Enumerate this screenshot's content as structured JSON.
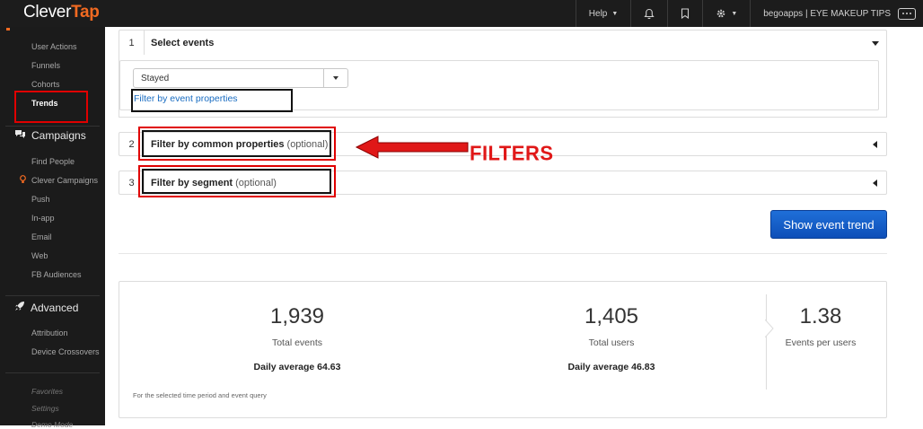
{
  "app": {
    "logo_clever": "Clever",
    "logo_tap": "Tap"
  },
  "topbar": {
    "help_label": "Help",
    "account_label": "begoapps | EYE MAKEUP TIPS",
    "bell_icon": "bell-icon",
    "bookmark_icon": "bookmark-icon",
    "gear_icon": "gear-icon"
  },
  "sidebar": {
    "analytics_items": [
      "User Actions",
      "Funnels",
      "Cohorts",
      "Trends"
    ],
    "active_item": "Trends",
    "campaigns_title": "Campaigns",
    "campaigns_items": [
      "Find People",
      "Clever Campaigns",
      "Push",
      "In-app",
      "Email",
      "Web",
      "FB Audiences"
    ],
    "advanced_title": "Advanced",
    "advanced_items": [
      "Attribution",
      "Device Crossovers"
    ],
    "footer_items": [
      "Favorites",
      "Settings",
      "Demo Mode"
    ]
  },
  "panels": {
    "select_events": {
      "num": "1",
      "title": "Select events"
    },
    "event_select_value": "Stayed",
    "filter_link": "Filter by event properties",
    "common_props": {
      "num": "2",
      "title": "Filter by common properties",
      "optional": "(optional)"
    },
    "segment": {
      "num": "3",
      "title": "Filter by segment",
      "optional": "(optional)"
    }
  },
  "annotation": {
    "filters_label": "FILTERS",
    "accent_color": "#e00000"
  },
  "actions": {
    "show_trend": "Show event trend",
    "button_color": "#1a5fc9"
  },
  "stats": {
    "total_events": {
      "value": "1,939",
      "label": "Total events",
      "daily": "Daily average 64.63"
    },
    "total_users": {
      "value": "1,405",
      "label": "Total users",
      "daily": "Daily average 46.83"
    },
    "events_per_user": {
      "value": "1.38",
      "label": "Events per users"
    },
    "note": "For the selected time period and event query"
  }
}
